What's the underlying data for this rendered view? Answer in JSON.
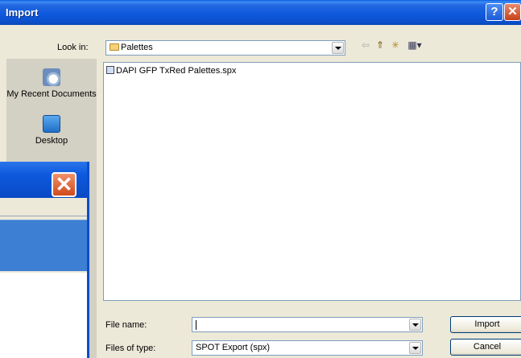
{
  "dialog": {
    "title": "Import",
    "help_glyph": "?",
    "close_glyph": "✕"
  },
  "lookin": {
    "label": "Look in:",
    "value": "Palettes"
  },
  "toolbar": {
    "back_glyph": "⇦",
    "up_glyph": "⇑",
    "new_folder_glyph": "✳",
    "views_glyph": "▦▾"
  },
  "places": [
    {
      "label": "My Recent Documents",
      "icon": "recent-documents-icon"
    },
    {
      "label": "Desktop",
      "icon": "desktop-icon"
    }
  ],
  "files": [
    {
      "name": "DAPI GFP TxRed Palettes.spx"
    }
  ],
  "filename": {
    "label": "File name:",
    "value": ""
  },
  "filetype": {
    "label": "Files of type:",
    "value": "SPOT Export (spx)"
  },
  "buttons": {
    "import": "Import",
    "cancel": "Cancel"
  },
  "background_window": {
    "close_glyph": "✕"
  }
}
